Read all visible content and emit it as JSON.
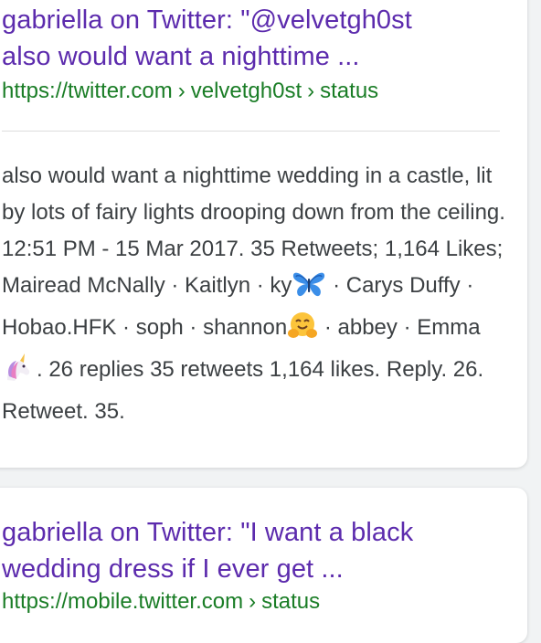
{
  "results": [
    {
      "title_line1": "gabriella on Twitter: \"@velvetgh0st",
      "title_line2": "also would want a nighttime ...",
      "url_domain": "https://twitter.com",
      "url_path1": "velvetgh0st",
      "url_path2": "status",
      "url_separator": "›",
      "snippet_part1": "also would want a nighttime wedding in a castle, lit by lots of fairy lights drooping down from the ceiling. 12:51 PM - 15 Mar 2017. 35 Retweets; 1,164 Likes; Mairead McNally · Kaitlyn · ky",
      "snippet_part2": " · Carys Duffy · Hobao.HFK · soph · shannon",
      "snippet_part3": " · abbey · Emma ",
      "snippet_part4": ". 26 replies 35 retweets 1,164 likes. Reply. 26. Retweet. 35.",
      "emoji_icons": [
        "butterfly-icon",
        "hugging-face-icon",
        "unicorn-icon"
      ]
    },
    {
      "title_line1": "gabriella on Twitter: \"I want a black",
      "title_line2": "wedding dress if I ever get ...",
      "url_domain": "https://mobile.twitter.com",
      "url_path1": "status",
      "url_separator": "›"
    }
  ],
  "colors": {
    "title": "#5c2bad",
    "url": "#1a7d26",
    "snippet": "#3c4043",
    "page_background": "#f1f3f4",
    "card_background": "#ffffff"
  }
}
